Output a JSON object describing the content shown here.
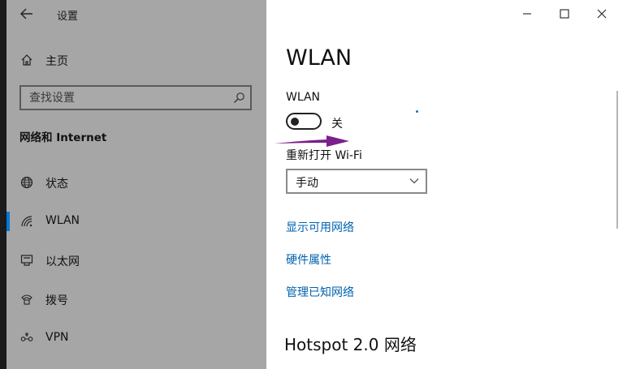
{
  "window": {
    "app_title": "设置",
    "back_icon": "back-arrow-icon",
    "controls": [
      "minimize-icon",
      "maximize-icon",
      "close-icon"
    ]
  },
  "sidebar": {
    "home_label": "主页",
    "search_placeholder": "查找设置",
    "section_title": "网络和 Internet",
    "items": [
      {
        "label": "状态",
        "icon": "globe-icon",
        "active": false
      },
      {
        "label": "WLAN",
        "icon": "wifi-icon",
        "active": true
      },
      {
        "label": "以太网",
        "icon": "ethernet-icon",
        "active": false
      },
      {
        "label": "拨号",
        "icon": "dialup-icon",
        "active": false
      },
      {
        "label": "VPN",
        "icon": "vpn-icon",
        "active": false
      }
    ]
  },
  "main": {
    "page_title": "WLAN",
    "wlan_label": "WLAN",
    "toggle_state": "关",
    "toggle_on": false,
    "reopen_label": "重新打开 Wi-Fi",
    "reopen_value": "手动",
    "links": [
      "显示可用网络",
      "硬件属性",
      "管理已知网络"
    ],
    "hotspot_heading": "Hotspot 2.0 网络"
  },
  "colors": {
    "sidebar_bg": "#a6a6a6",
    "accent": "#0078d7",
    "link": "#0063b1",
    "annotation_arrow": "#7b1f8a"
  }
}
